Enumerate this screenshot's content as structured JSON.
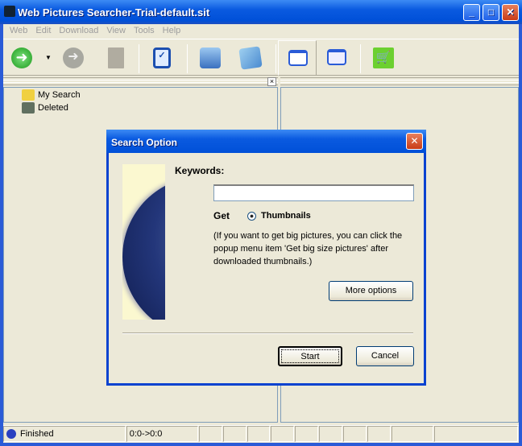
{
  "window": {
    "title": "Web Pictures Searcher-Trial-default.sit"
  },
  "menu": [
    "Web",
    "Edit",
    "Download",
    "View",
    "Tools",
    "Help"
  ],
  "tree": [
    {
      "label": "My Search"
    },
    {
      "label": "Deleted"
    }
  ],
  "status": {
    "message": "Finished",
    "range": "0:0->0:0"
  },
  "dialog": {
    "title": "Search Option",
    "keywords_label": "Keywords:",
    "keywords_value": "",
    "get_label": "Get",
    "option_label": "Thumbnails",
    "hint": "(If you want to get big pictures, you can click the popup menu item 'Get big size pictures' after downloaded thumbnails.)",
    "more_options": "More options",
    "start": "Start",
    "cancel": "Cancel"
  }
}
